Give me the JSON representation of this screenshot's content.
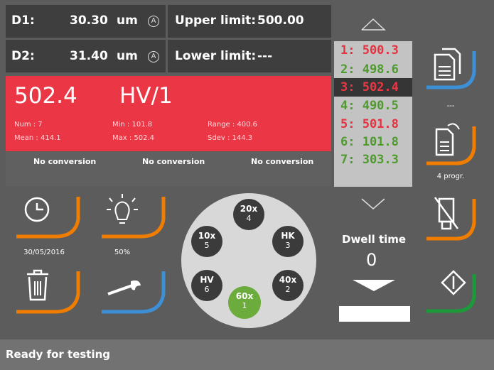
{
  "measurements": {
    "d1": {
      "label": "D1:",
      "value": "30.30",
      "unit": "um",
      "mode": "A"
    },
    "d2": {
      "label": "D2:",
      "value": "31.40",
      "unit": "um",
      "mode": "A"
    },
    "upper_limit": {
      "label": "Upper limit:",
      "value": "500.00"
    },
    "lower_limit": {
      "label": "Lower limit:",
      "value": "---"
    }
  },
  "result": {
    "value": "502.4",
    "scale": "HV/1",
    "num": "Num : 7",
    "mean": "Mean : 414.1",
    "min": "Min : 101.8",
    "max": "Max : 502.4",
    "range": "Range : 400.6",
    "sdev": "Sdev : 144.3"
  },
  "conversions": [
    "No conversion",
    "No conversion",
    "No conversion"
  ],
  "history": [
    {
      "text": "1: 500.3",
      "color": "#e53240"
    },
    {
      "text": "2: 498.6",
      "color": "#4f9a2f"
    },
    {
      "text": "3: 502.4",
      "color": "#e53240",
      "selected": true
    },
    {
      "text": "4: 490.5",
      "color": "#4f9a2f"
    },
    {
      "text": "5: 501.8",
      "color": "#e53240"
    },
    {
      "text": "6: 101.8",
      "color": "#4f9a2f"
    },
    {
      "text": "7: 303.3",
      "color": "#4f9a2f"
    }
  ],
  "right_panel": {
    "report_caption": "---",
    "program_caption": "4 progr."
  },
  "left_tiles": {
    "date": "30/05/2016",
    "light": "50%"
  },
  "turret": {
    "pos4": {
      "big": "20x",
      "small": "4"
    },
    "pos5": {
      "big": "10x",
      "small": "5"
    },
    "pos3": {
      "big": "HK",
      "small": "3"
    },
    "pos6": {
      "big": "HV",
      "small": "6"
    },
    "pos2": {
      "big": "40x",
      "small": "2"
    },
    "pos1": {
      "big": "60x",
      "small": "1"
    }
  },
  "dwell": {
    "label": "Dwell time",
    "value": "0"
  },
  "status": "Ready for testing",
  "colors": {
    "orange": "#f07d00",
    "blue": "#3d8fd6",
    "green": "#1c9a3a",
    "red": "#ea3645",
    "active": "#6cac3c"
  }
}
